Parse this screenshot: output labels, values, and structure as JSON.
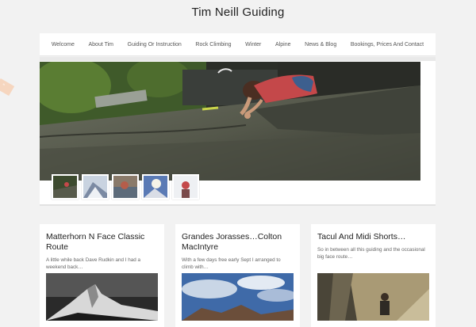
{
  "site": {
    "title": "Tim Neill Guiding"
  },
  "nav": {
    "items": [
      "Welcome",
      "About Tim",
      "Guiding Or Instruction",
      "Rock Climbing",
      "Winter",
      "Alpine",
      "News & Blog",
      "Bookings, Prices And Contact"
    ]
  },
  "slider": {
    "thumbnail_count": 5
  },
  "posts": [
    {
      "title": "Matterhorn N Face Classic Route",
      "excerpt": "A little while back Dave Rudkin and I had a weekend back…"
    },
    {
      "title": "Grandes Jorasses…Colton MacIntyre",
      "excerpt": "With a few days free early Sept I arranged to climb with…"
    },
    {
      "title": "Tacul And Midi Shorts…",
      "excerpt": "So in between all this guiding and the occasional big face route…"
    }
  ],
  "colors": {
    "background": "#f2f2f2",
    "panel": "#ffffff",
    "nav_text": "#555555",
    "title_text": "#222222"
  }
}
